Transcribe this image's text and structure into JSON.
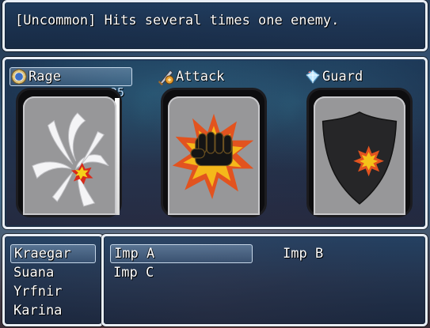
{
  "help": {
    "text": "[Uncommon] Hits several times one enemy."
  },
  "skills": {
    "items": [
      {
        "label": "Rage",
        "icon": "rage-icon",
        "selected": true,
        "cost": "25"
      },
      {
        "label": "Attack",
        "icon": "attack-icon",
        "selected": false
      },
      {
        "label": "Guard",
        "icon": "guard-icon",
        "selected": false
      }
    ]
  },
  "party": {
    "members": [
      "Kraegar",
      "Suana",
      "Yrfnir",
      "Karina"
    ],
    "selected_index": 0
  },
  "targets": {
    "enemies": [
      "Imp A",
      "Imp B",
      "Imp C"
    ],
    "selected_index": 0
  },
  "colors": {
    "window_border": "#e8eef6",
    "window_fill": "#1e3c5f",
    "card_face": "#979799",
    "card_frame": "#0d0d0f",
    "burst_outer": "#e2531f",
    "burst_inner": "#f5b81a",
    "cost_text": "#bfe0ff"
  }
}
